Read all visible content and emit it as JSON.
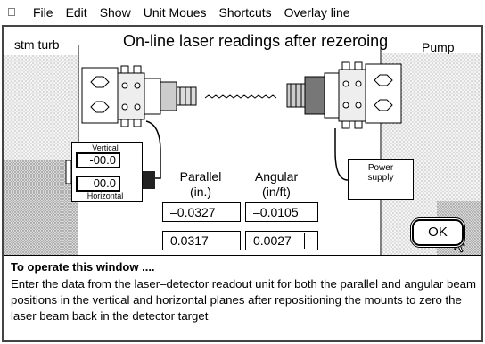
{
  "menubar": {
    "apple_icon": "apple-icon",
    "items": [
      "File",
      "Edit",
      "Show",
      "Unit Moues",
      "Shortcuts",
      "Overlay line"
    ]
  },
  "window": {
    "title": "On-line laser readings after rezeroing",
    "left_machine": "stm turb",
    "right_machine": "Pump"
  },
  "readout_unit": {
    "vertical_label": "Vertical",
    "vertical_value": "-00.0",
    "horizontal_label": "Horizontal",
    "horizontal_value": "00.0"
  },
  "power_supply": {
    "label_line1": "Power",
    "label_line2": "supply"
  },
  "columns": {
    "parallel_line1": "Parallel",
    "parallel_line2": "(in.)",
    "angular_line1": "Angular",
    "angular_line2": "(in/ft)"
  },
  "fields": {
    "parallel_vertical": "–0.0327",
    "angular_vertical": "–0.0105",
    "parallel_horizontal": "0.0317",
    "angular_horizontal": "0.0027"
  },
  "ok_button": {
    "label": "OK"
  },
  "help": {
    "title": "To operate this window ....",
    "body": "Enter the data from the laser–detector readout unit for both the parallel and angular beam positions in the vertical and horizontal planes after repositioning the mounts to zero the laser beam back in the detector target"
  }
}
